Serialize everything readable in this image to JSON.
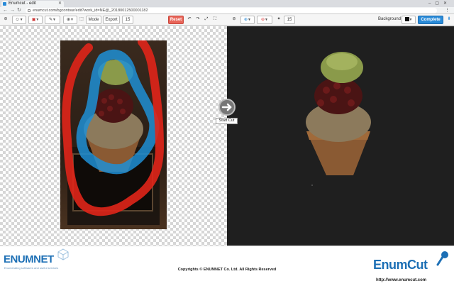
{
  "browser": {
    "tab_title": "Enumcut - edit",
    "url": "enumcut.com/bgcontour/edit?work_id=NE@_20180012500001182"
  },
  "toolbar": {
    "mode_label": "Mode",
    "export_label": "Export",
    "brush_size_1": "15",
    "reset_label": "Reset",
    "brush_size_2": "15",
    "background_label": "Background",
    "background_color": "#111111",
    "complete_label": "Complete",
    "accent_red": "#e8665a",
    "accent_blue": "#2a8bd8"
  },
  "canvas": {
    "start_cut_label": "Start Cut",
    "foreground_stroke_color": "#1e8fd5",
    "background_stroke_color": "#e0251a"
  },
  "footer": {
    "left_logo": "ENUMNET",
    "left_tagline": "Enumerating softwares and useful services",
    "copyright": "Copyrights © ENUMNET Co. Ltd. All Rights Reserved",
    "right_logo": "EnumCut",
    "right_url": "http://www.enumcut.com"
  }
}
